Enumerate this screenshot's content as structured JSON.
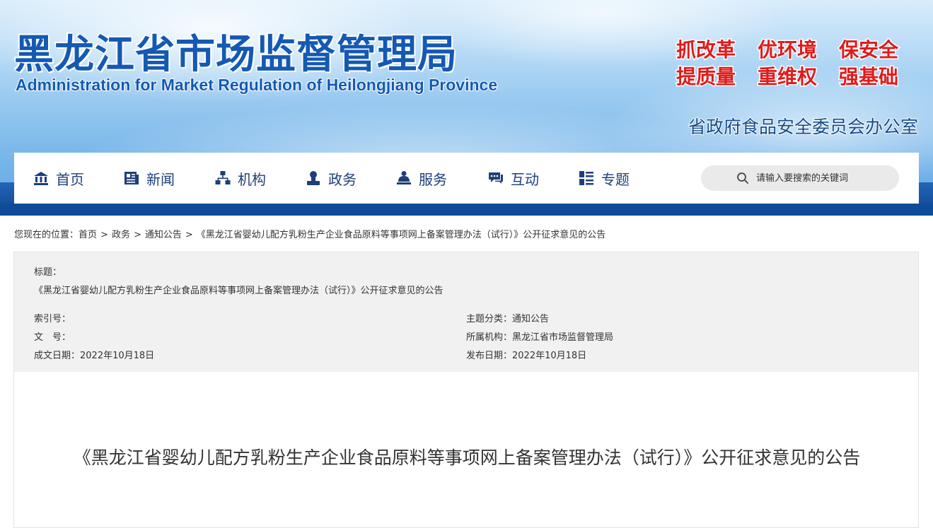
{
  "site": {
    "title_cn": "黑龙江省市场监督管理局",
    "title_en": "Administration for Market Regulation of Heilongjiang Province",
    "slogans": [
      "抓改革",
      "优环境",
      "保安全",
      "提质量",
      "重维权",
      "强基础"
    ],
    "office_name": "省政府食品安全委员会办公室"
  },
  "nav": {
    "items": [
      {
        "label": "首页",
        "icon": "home-icon"
      },
      {
        "label": "新闻",
        "icon": "news-icon"
      },
      {
        "label": "机构",
        "icon": "org-icon"
      },
      {
        "label": "政务",
        "icon": "affairs-icon"
      },
      {
        "label": "服务",
        "icon": "service-icon"
      },
      {
        "label": "互动",
        "icon": "chat-icon"
      },
      {
        "label": "专题",
        "icon": "topics-icon"
      }
    ],
    "search_placeholder": "请输入要搜索的关键词"
  },
  "breadcrumb": {
    "prefix": "您现在的位置：",
    "items": [
      "首页",
      "政务",
      "通知公告",
      "《黑龙江省婴幼儿配方乳粉生产企业食品原料等事项网上备案管理办法（试行）》公开征求意见的公告"
    ],
    "separator": ">"
  },
  "info": {
    "title_label": "标题：",
    "title_value": "《黑龙江省婴幼儿配方乳粉生产企业食品原料等事项网上备案管理办法（试行）》公开征求意见的公告",
    "index_label": "索引号：",
    "index_value": "",
    "doc_no_label": "文　号：",
    "doc_no_value": "",
    "created_label": "成文日期：",
    "created_value": "2022年10月18日",
    "category_label": "主题分类：",
    "category_value": "通知公告",
    "agency_label": "所属机构：",
    "agency_value": "黑龙江省市场监督管理局",
    "published_label": "发布日期：",
    "published_value": "2022年10月18日"
  },
  "article": {
    "title": "《黑龙江省婴幼儿配方乳粉生产企业食品原料等事项网上备案管理办法（试行）》公开征求意见的公告"
  },
  "colors": {
    "brand_blue": "#1459b3",
    "nav_text": "#1d3f7a",
    "nav_bar_band": "#0d4c98",
    "slogan_red": "#e01b1b"
  }
}
